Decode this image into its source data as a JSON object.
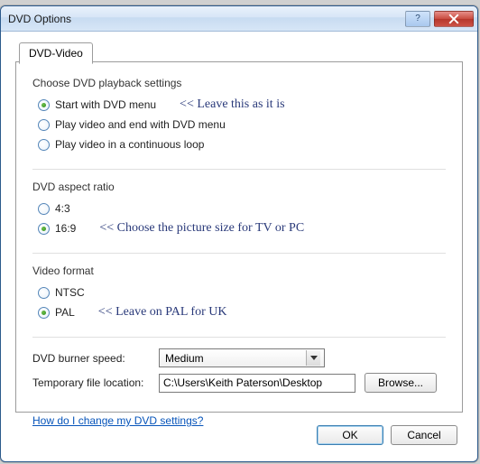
{
  "window": {
    "title": "DVD Options"
  },
  "tabs": [
    {
      "label": "DVD-Video"
    }
  ],
  "groups": {
    "playback": {
      "title": "Choose DVD playback settings",
      "options": [
        {
          "label": "Start with DVD menu",
          "checked": true
        },
        {
          "label": "Play video and end with DVD menu",
          "checked": false
        },
        {
          "label": "Play video in a continuous loop",
          "checked": false
        }
      ],
      "annotation": "<< Leave this as it is"
    },
    "aspect": {
      "title": "DVD aspect ratio",
      "options": [
        {
          "label": "4:3",
          "checked": false
        },
        {
          "label": "16:9",
          "checked": true
        }
      ],
      "annotation": "<< Choose the picture size for TV or PC"
    },
    "format": {
      "title": "Video format",
      "options": [
        {
          "label": "NTSC",
          "checked": false
        },
        {
          "label": "PAL",
          "checked": true
        }
      ],
      "annotation": "<< Leave on PAL for UK"
    }
  },
  "burner": {
    "label": "DVD burner speed:",
    "value": "Medium"
  },
  "templocation": {
    "label": "Temporary file location:",
    "value": "C:\\Users\\Keith Paterson\\Desktop"
  },
  "buttons": {
    "browse": "Browse...",
    "ok": "OK",
    "cancel": "Cancel"
  },
  "help_link": "How do I change my DVD settings?"
}
